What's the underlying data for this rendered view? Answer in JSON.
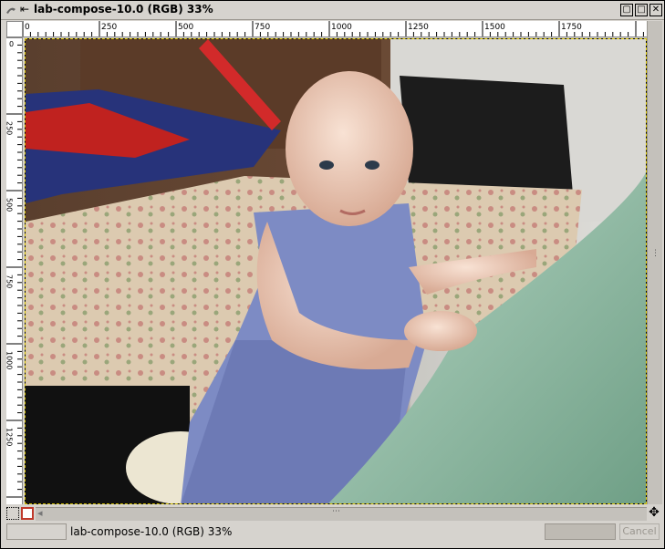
{
  "window": {
    "title": "lab-compose-10.0 (RGB) 33%",
    "buttons": {
      "menu": "▢",
      "maximize": "□",
      "close": "✕"
    }
  },
  "rulers": {
    "horizontal_labels": [
      "0",
      "250",
      "500",
      "750",
      "1000",
      "1250",
      "1500",
      "1750"
    ],
    "vertical_labels": [
      "0",
      "250",
      "500",
      "750",
      "1000",
      "1250"
    ]
  },
  "image": {
    "description_icon": "photo-canvas"
  },
  "status": {
    "text": "lab-compose-10.0 (RGB) 33%",
    "cancel_label": "Cancel"
  },
  "icons": {
    "navigate": "✥",
    "scroll_left": "◂",
    "scroll_up": "▴",
    "scroll_down": "▾"
  }
}
